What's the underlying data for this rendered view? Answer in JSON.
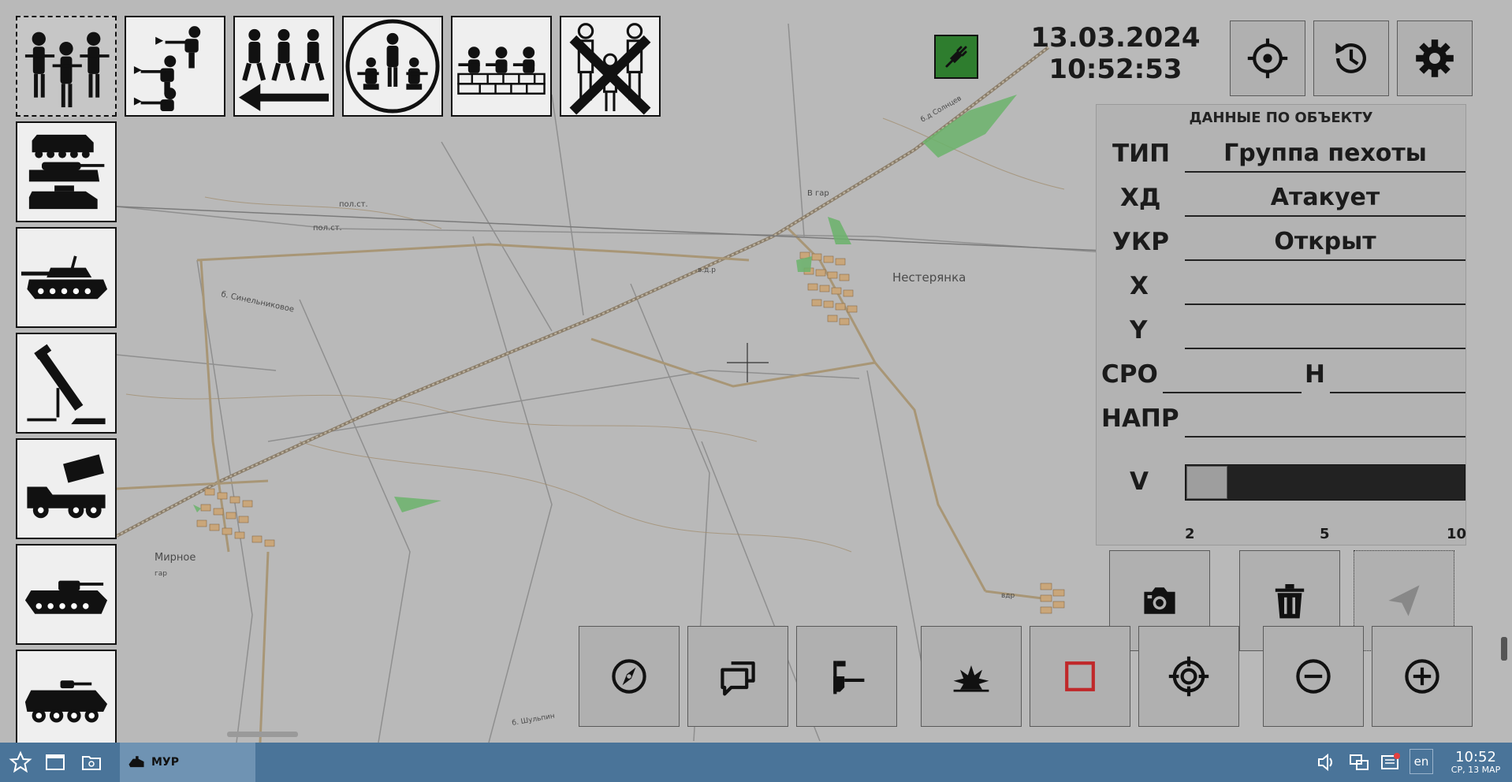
{
  "toolbar": {
    "selected_icon": "infantry-group-icon",
    "unit_states": [
      "infantry-group-icon",
      "infantry-attacking-icon",
      "infantry-retreating-icon",
      "infantry-encircled-icon",
      "infantry-entrenched-icon",
      "infantry-destroyed-icon"
    ],
    "unit_types": [
      "armored-column-icon",
      "tank-icon",
      "mortar-icon",
      "rocket-launcher-truck-icon",
      "infantry-fighting-vehicle-icon",
      "armored-personnel-carrier-icon"
    ]
  },
  "header": {
    "date": "13.03.2024",
    "time": "10:52:53",
    "status_color": "#2e7d2e",
    "buttons": [
      "crosshair-icon",
      "history-icon",
      "gear-icon"
    ]
  },
  "panel": {
    "title": "ДАННЫЕ ПО ОБЪЕКТУ",
    "type_label": "ТИП",
    "type_value": "Группа пехоты",
    "action_label": "ХД",
    "action_value": "Атакует",
    "cover_label": "УКР",
    "cover_value": "Открыт",
    "x_label": "X",
    "x_value": "",
    "y_label": "Y",
    "y_value": "",
    "sro_label": "СРО",
    "sro_value": "",
    "h_label": "Н",
    "h_value": "",
    "dir_label": "НАПР",
    "dir_value": "",
    "v_label": "V",
    "v_ticks": [
      "2",
      "5",
      "10"
    ],
    "v_level": 0.0
  },
  "panel_buttons": [
    "camera-icon",
    "trash-icon",
    "send-icon"
  ],
  "bottom_bar": [
    "compass-icon",
    "chat-icon",
    "measure-icon",
    "explosion-icon",
    "red-square-icon",
    "target-icon",
    "zoom-out-icon",
    "zoom-in-icon"
  ],
  "map": {
    "places": [
      {
        "name": "Нестерянка"
      },
      {
        "name": "Мирное"
      },
      {
        "name": "пол.ст."
      },
      {
        "name": "пол.ст."
      },
      {
        "name": "б. Синельниковое"
      },
      {
        "name": "в.д.р"
      },
      {
        "name": "гар"
      },
      {
        "name": "В гар"
      },
      {
        "name": "б.д Солнцев"
      },
      {
        "name": "б. Шульпин"
      },
      {
        "name": "вдр"
      }
    ]
  },
  "taskbar": {
    "app_label": "МУР",
    "lang": "en",
    "clock_time": "10:52",
    "clock_date": "СР, 13 МАР"
  }
}
